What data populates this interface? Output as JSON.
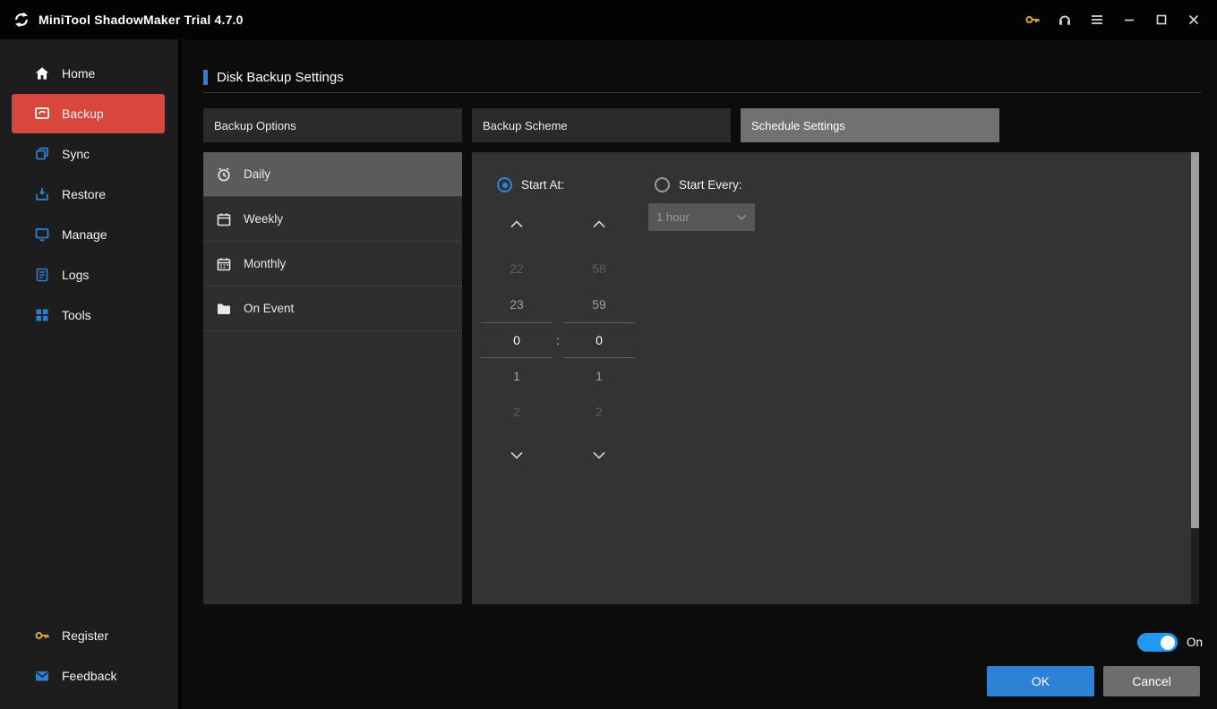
{
  "titlebar": {
    "app_title": "MiniTool ShadowMaker Trial 4.7.0"
  },
  "sidebar": {
    "items": [
      {
        "label": "Home"
      },
      {
        "label": "Backup"
      },
      {
        "label": "Sync"
      },
      {
        "label": "Restore"
      },
      {
        "label": "Manage"
      },
      {
        "label": "Logs"
      },
      {
        "label": "Tools"
      }
    ],
    "bottom_items": [
      {
        "label": "Register"
      },
      {
        "label": "Feedback"
      }
    ]
  },
  "main": {
    "page_title": "Disk Backup Settings",
    "tabs": [
      {
        "label": "Backup Options"
      },
      {
        "label": "Backup Scheme"
      },
      {
        "label": "Schedule Settings"
      }
    ],
    "schedule_types": [
      {
        "label": "Daily"
      },
      {
        "label": "Weekly"
      },
      {
        "label": "Monthly"
      },
      {
        "label": "On Event"
      }
    ],
    "start_at_label": "Start At:",
    "start_every_label": "Start Every:",
    "interval_value": "1 hour",
    "time_separator": ":",
    "hour_values": [
      "22",
      "23",
      "0",
      "1",
      "2"
    ],
    "minute_values": [
      "58",
      "59",
      "0",
      "1",
      "2"
    ],
    "toggle_state": "On",
    "ok_label": "OK",
    "cancel_label": "Cancel"
  },
  "colors": {
    "accent_blue": "#2d7fd3",
    "selected_red": "#d8463c",
    "toggle_on": "#1e9af0",
    "ok_blue": "#2e82d6"
  }
}
